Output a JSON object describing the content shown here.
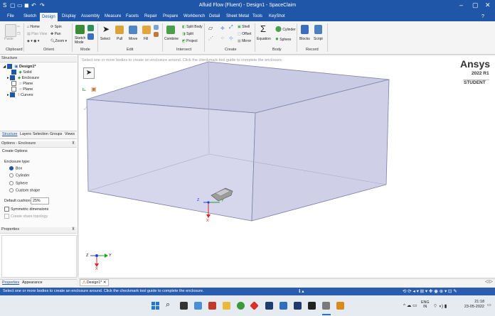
{
  "window": {
    "title": "Afluid Flow (Fluent) - Design1 - SpaceClaim"
  },
  "menu": {
    "items": [
      "File",
      "Sketch",
      "Design",
      "Display",
      "Assembly",
      "Measure",
      "Facets",
      "Repair",
      "Prepare",
      "Workbench",
      "Detail",
      "Sheet Metal",
      "Tools",
      "KeyShot"
    ],
    "active": "Design"
  },
  "ribbon": {
    "clipboard": {
      "paste": "Paste",
      "group": "Clipboard"
    },
    "orient": {
      "home": "Home",
      "plan_view": "Plan View",
      "spin": "Spin",
      "pan": "Pan",
      "zoom": "Zoom",
      "group": "Orient"
    },
    "mode": {
      "sketch_mode": "Sketch Mode",
      "group": "Mode"
    },
    "edit": {
      "select": "Select",
      "pull": "Pull",
      "move": "Move",
      "fill": "Fill",
      "group": "Edit"
    },
    "intersect": {
      "combine": "Combine",
      "split_body": "Split Body",
      "split": "Split",
      "project": "Project",
      "group": "Intersect"
    },
    "create": {
      "shell": "Shell",
      "offset": "Offset",
      "mirror": "Mirror",
      "group": "Create"
    },
    "body": {
      "equation": "Equation",
      "cylinder": "Cylinder",
      "sphere": "Sphere",
      "group": "Body"
    },
    "record": {
      "blocks": "Blocks",
      "script": "Script",
      "group": "Record"
    }
  },
  "structure": {
    "header": "Structure",
    "items": [
      {
        "label": "Design1*",
        "level": 0
      },
      {
        "label": "Solid",
        "level": 1
      },
      {
        "label": "Enclosure",
        "level": 1
      },
      {
        "label": "Plane",
        "level": 1
      },
      {
        "label": "Plane",
        "level": 1
      },
      {
        "label": "Curves",
        "level": 1
      }
    ]
  },
  "panel_tabs": [
    "Structure",
    "Layers",
    "Selection",
    "Groups",
    "Views"
  ],
  "options": {
    "header": "Options - Enclosure",
    "sub_header": "Create Options",
    "enclosure_type_label": "Enclosure type:",
    "types": [
      "Box",
      "Cylinder",
      "Sphere",
      "Custom shape"
    ],
    "selected_type": "Box",
    "default_cushion_label": "Default cushion:",
    "default_cushion_value": "25%",
    "symmetric_label": "Symmetric dimensions",
    "share_topology_label": "Create share topology"
  },
  "properties": {
    "header": "Properties"
  },
  "bottom_tabs": [
    "Properties",
    "Appearance"
  ],
  "viewport": {
    "hint": "Select one or more bodies to create an enclosure around. Click the checkmark tool guide to complete the enclosure.",
    "doc_tab": "Design1*",
    "brand": "Ansys",
    "version": "2022 R1",
    "edition": "STUDENT",
    "triad_labels": {
      "x": "X",
      "y": "Y",
      "z": "Z"
    },
    "colors": {
      "enclosure_fill": "#cfd0e8",
      "enclosure_edge": "#7e7fa6",
      "accent": "#1f56a8"
    }
  },
  "status": {
    "message": "Select one or more bodies to create an enclosure around. Click the checkmark tool guide to complete the enclosure."
  },
  "taskbar": {
    "language": "ENG",
    "region": "IN",
    "time": "21:18",
    "date": "23-05-2022"
  }
}
